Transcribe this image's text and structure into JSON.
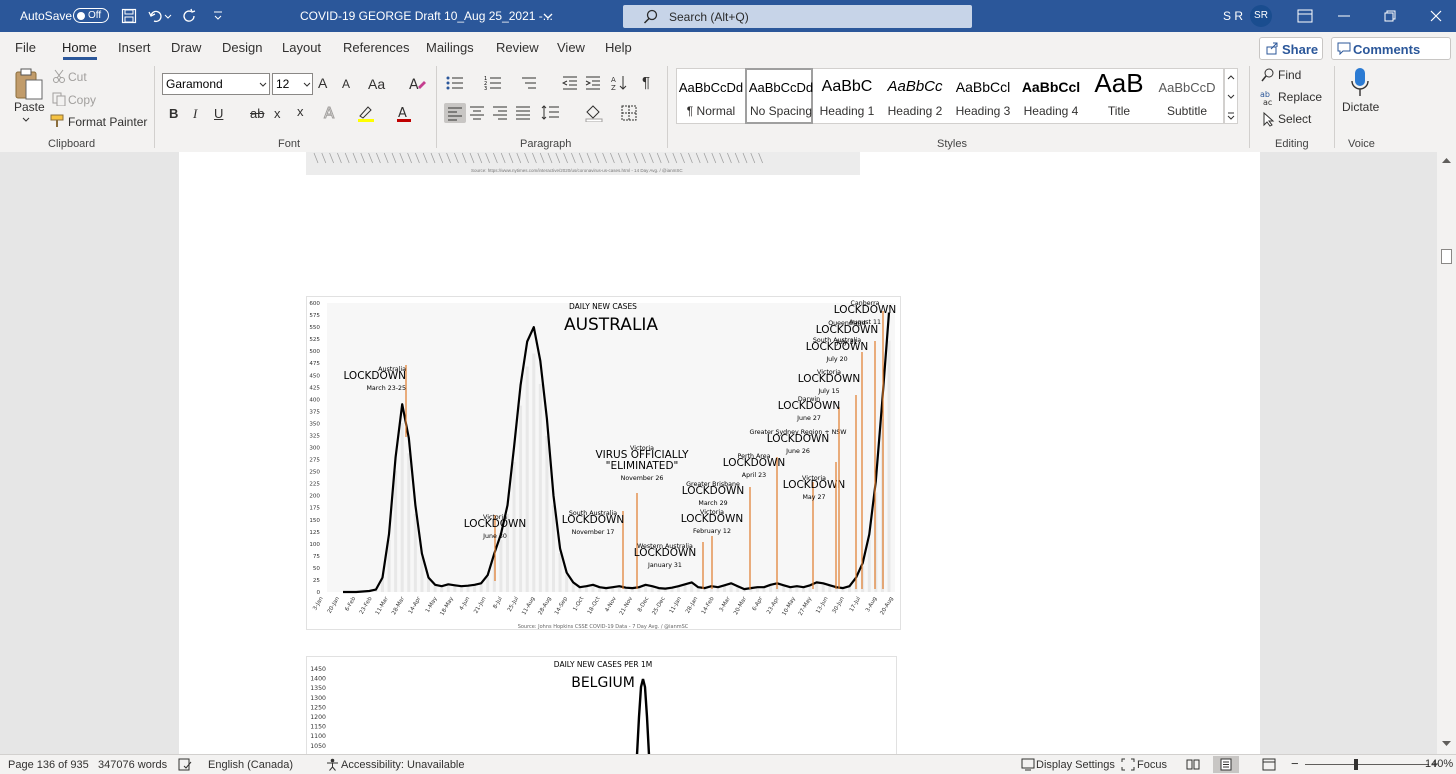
{
  "titlebar": {
    "autosave_label": "AutoSave",
    "autosave_state": "Off",
    "doc_title": "COVID-19 GEORGE Draft 10_Aug 25_2021  -...",
    "search_placeholder": "Search (Alt+Q)",
    "user_initials_text": "S R",
    "avatar_initials": "SR"
  },
  "tabs": [
    "File",
    "Home",
    "Insert",
    "Draw",
    "Design",
    "Layout",
    "References",
    "Mailings",
    "Review",
    "View",
    "Help"
  ],
  "share_label": "Share",
  "comments_label": "Comments",
  "clipboard": {
    "paste": "Paste",
    "cut": "Cut",
    "copy": "Copy",
    "format_painter": "Format Painter",
    "group": "Clipboard"
  },
  "font": {
    "name": "Garamond",
    "size": "12",
    "group": "Font",
    "grow": "A",
    "shrink": "A",
    "case": "Aa",
    "bold": "B",
    "italic": "I",
    "underline": "U",
    "strike": "ab",
    "sub": "x",
    "sup": "x"
  },
  "paragraph": {
    "group": "Paragraph",
    "pilcrow": "¶"
  },
  "styles": {
    "group": "Styles",
    "items": [
      {
        "sample": "AaBbCcDd",
        "name": "¶ Normal"
      },
      {
        "sample": "AaBbCcDd",
        "name": "No Spacing"
      },
      {
        "sample": "AaBbC",
        "name": "Heading 1"
      },
      {
        "sample": "AaBbCc",
        "name": "Heading 2"
      },
      {
        "sample": "AaBbCcl",
        "name": "Heading 3"
      },
      {
        "sample": "AaBbCcl",
        "name": "Heading 4"
      },
      {
        "sample": "AaB",
        "name": "Title"
      },
      {
        "sample": "AaBbCcD",
        "name": "Subtitle"
      }
    ]
  },
  "editing": {
    "group": "Editing",
    "find": "Find",
    "replace": "Replace",
    "select": "Select"
  },
  "voice": {
    "group": "Voice",
    "dictate": "Dictate"
  },
  "chart_top_source": "Source: https://www.nytimes.com/interactive/2020/us/coronavirus-us-cases.html - 14 Day Avg. / @ianmSC",
  "chart_data": [
    {
      "type": "line",
      "title": "DAILY NEW CASES",
      "subtitle": "AUSTRALIA",
      "source": "Source: Johns Hopkins CSSE COVID-19 Data - 7 Day Avg. / @ianmSC",
      "ylim": [
        0,
        600
      ],
      "yticks": [
        0,
        25,
        50,
        75,
        100,
        125,
        150,
        175,
        200,
        225,
        250,
        275,
        300,
        325,
        350,
        375,
        400,
        425,
        450,
        475,
        500,
        525,
        550,
        575,
        600
      ],
      "xticks": [
        "3-Jan",
        "20-Jan",
        "6-Feb",
        "23-Feb",
        "11-Mar",
        "28-Mar",
        "14-Apr",
        "1-May",
        "18-May",
        "4-Jun",
        "21-Jun",
        "8-Jul",
        "25-Jul",
        "11-Aug",
        "28-Aug",
        "14-Sep",
        "1-Oct",
        "18-Oct",
        "4-Nov",
        "21-Nov",
        "8-Dec",
        "25-Dec",
        "11-Jan",
        "28-Jan",
        "14-Feb",
        "3-Mar",
        "20-Mar",
        "6-Apr",
        "23-Apr",
        "10-May",
        "27-May",
        "13-Jun",
        "30-Jun",
        "17-Jul",
        "3-Aug",
        "20-Aug"
      ],
      "series": [
        {
          "values": [
            0,
            0,
            0,
            1,
            2,
            5,
            30,
            120,
            280,
            390,
            320,
            180,
            80,
            30,
            15,
            12,
            16,
            14,
            12,
            13,
            15,
            18,
            35,
            80,
            120,
            180,
            300,
            430,
            520,
            550,
            480,
            360,
            200,
            90,
            40,
            20,
            10,
            12,
            15,
            10,
            8,
            10,
            12,
            9,
            8,
            10,
            15,
            12,
            8,
            7,
            9,
            12,
            16,
            20,
            10,
            8,
            12,
            10,
            14,
            18,
            12,
            6,
            8,
            10,
            10,
            15,
            18,
            14,
            10,
            12,
            10,
            14,
            20,
            18,
            14,
            10,
            8,
            12,
            30,
            60,
            120,
            230,
            400,
            580
          ]
        }
      ],
      "annotations": [
        {
          "lines": [
            "Australia",
            "LOCKDOWN",
            "March 23-25"
          ]
        },
        {
          "lines": [
            "Victoria",
            "LOCKDOWN",
            "June 30"
          ]
        },
        {
          "lines": [
            "South Australia",
            "LOCKDOWN",
            "November 17"
          ]
        },
        {
          "lines": [
            "Victoria",
            "VIRUS OFFICIALLY",
            "\"ELIMINATED\"",
            "November 26"
          ]
        },
        {
          "lines": [
            "Western Australia",
            "LOCKDOWN",
            "January 31"
          ]
        },
        {
          "lines": [
            "Victoria",
            "LOCKDOWN",
            "February 12"
          ]
        },
        {
          "lines": [
            "Greater Brisbane",
            "LOCKDOWN",
            "March 29"
          ]
        },
        {
          "lines": [
            "Perth Area",
            "LOCKDOWN",
            "April 23"
          ]
        },
        {
          "lines": [
            "Victoria",
            "LOCKDOWN",
            "May 27"
          ]
        },
        {
          "lines": [
            "Greater Sydney Region + NSW",
            "LOCKDOWN",
            "June 26"
          ]
        },
        {
          "lines": [
            "Darwin",
            "LOCKDOWN",
            "June 27"
          ]
        },
        {
          "lines": [
            "Victoria",
            "LOCKDOWN",
            "July 15"
          ]
        },
        {
          "lines": [
            "South Australia",
            "LOCKDOWN",
            "July 20"
          ]
        },
        {
          "lines": [
            "Queensland",
            "LOCKDOWN",
            "July 31"
          ]
        },
        {
          "lines": [
            "Canberra",
            "LOCKDOWN",
            "August 11"
          ]
        }
      ]
    },
    {
      "type": "line",
      "title": "DAILY NEW CASES PER 1M",
      "subtitle": "BELGIUM",
      "yticks": [
        1050,
        1100,
        1150,
        1200,
        1250,
        1300,
        1350,
        1400,
        1450
      ]
    }
  ],
  "status": {
    "page": "Page 136 of 935",
    "words": "347076 words",
    "language": "English (Canada)",
    "accessibility": "Accessibility: Unavailable",
    "display_settings": "Display Settings",
    "focus": "Focus",
    "zoom": "140%",
    "zoom_minus": "−",
    "zoom_plus": "+"
  }
}
